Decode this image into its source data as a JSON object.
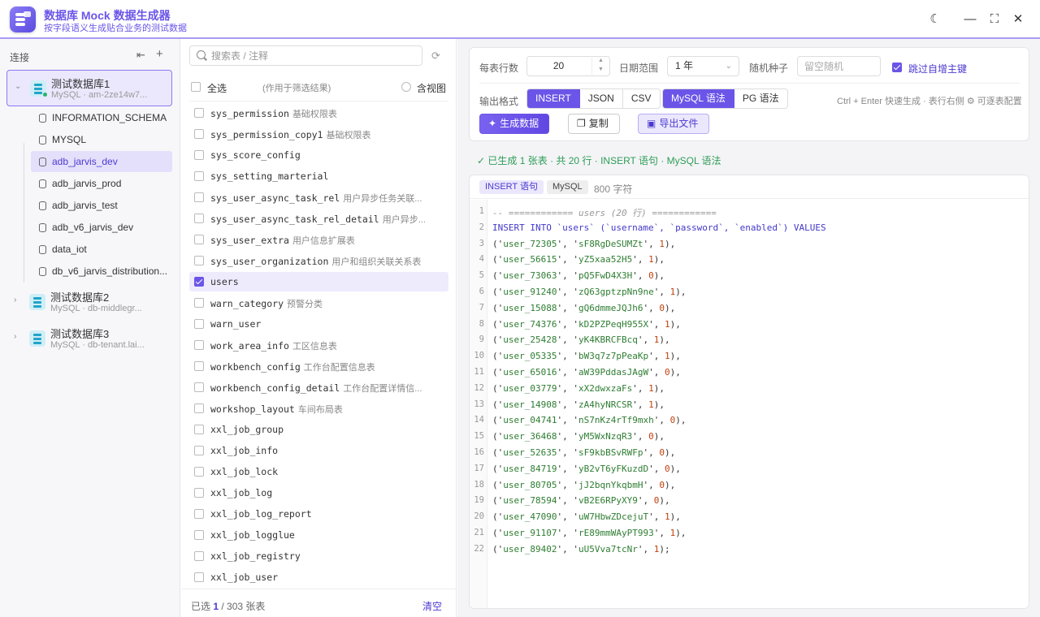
{
  "app": {
    "title": "数据库 Mock 数据生成器",
    "subtitle": "按字段语义生成贴合业务的测试数据"
  },
  "left": {
    "header": "连接",
    "connections": [
      {
        "name": "测试数据库1",
        "sub": "MySQL · am-2ze14w7...",
        "expanded": true
      },
      {
        "name": "测试数据库2",
        "sub": "MySQL · db-middlegr...",
        "expanded": false
      },
      {
        "name": "测试数据库3",
        "sub": "MySQL · db-tenant.lai...",
        "expanded": false
      }
    ],
    "databases": [
      "INFORMATION_SCHEMA",
      "MYSQL",
      "adb_jarvis_dev",
      "adb_jarvis_prod",
      "adb_jarvis_test",
      "adb_v6_jarvis_dev",
      "data_iot",
      "db_v6_jarvis_distribution..."
    ],
    "active_db": "adb_jarvis_dev"
  },
  "mid": {
    "search_placeholder": "搜索表 / 注释",
    "select_all": "全选",
    "select_hint": "(作用于筛选结果)",
    "include_views": "含视图",
    "tables": [
      {
        "name": "sys_permission",
        "comment": "基础权限表",
        "checked": false
      },
      {
        "name": "sys_permission_copy1",
        "comment": "基础权限表",
        "checked": false
      },
      {
        "name": "sys_score_config",
        "comment": "",
        "checked": false
      },
      {
        "name": "sys_setting_marterial",
        "comment": "",
        "checked": false
      },
      {
        "name": "sys_user_async_task_rel",
        "comment": "用户异步任务关联...",
        "checked": false
      },
      {
        "name": "sys_user_async_task_rel_detail",
        "comment": "用户异步...",
        "checked": false
      },
      {
        "name": "sys_user_extra",
        "comment": "用户信息扩展表",
        "checked": false
      },
      {
        "name": "sys_user_organization",
        "comment": "用户和组织关联关系表",
        "checked": false
      },
      {
        "name": "users",
        "comment": "",
        "checked": true
      },
      {
        "name": "warn_category",
        "comment": "预警分类",
        "checked": false
      },
      {
        "name": "warn_user",
        "comment": "",
        "checked": false
      },
      {
        "name": "work_area_info",
        "comment": "工区信息表",
        "checked": false
      },
      {
        "name": "workbench_config",
        "comment": "工作台配置信息表",
        "checked": false
      },
      {
        "name": "workbench_config_detail",
        "comment": "工作台配置详情信...",
        "checked": false
      },
      {
        "name": "workshop_layout",
        "comment": "车间布局表",
        "checked": false
      },
      {
        "name": "xxl_job_group",
        "comment": "",
        "checked": false
      },
      {
        "name": "xxl_job_info",
        "comment": "",
        "checked": false
      },
      {
        "name": "xxl_job_lock",
        "comment": "",
        "checked": false
      },
      {
        "name": "xxl_job_log",
        "comment": "",
        "checked": false
      },
      {
        "name": "xxl_job_log_report",
        "comment": "",
        "checked": false
      },
      {
        "name": "xxl_job_logglue",
        "comment": "",
        "checked": false
      },
      {
        "name": "xxl_job_registry",
        "comment": "",
        "checked": false
      },
      {
        "name": "xxl_job_user",
        "comment": "",
        "checked": false
      }
    ],
    "footer": {
      "prefix": "已选 ",
      "selected": "1",
      "suffix": " / 303 张表",
      "clear": "清空"
    }
  },
  "config": {
    "rows_label": "每表行数",
    "rows_value": "20",
    "date_label": "日期范围",
    "date_value": "1 年",
    "seed_label": "随机种子",
    "seed_placeholder": "留空随机",
    "skip_label": "跳过自增主键",
    "skip_checked": true,
    "format_label": "输出格式",
    "formats": [
      "INSERT",
      "JSON",
      "CSV"
    ],
    "active_format": "INSERT",
    "dialects": [
      "MySQL 语法",
      "PG 语法"
    ],
    "active_dialect": "MySQL 语法",
    "shortcut_hint": "Ctrl + Enter 快速生成 · 表行右侧 ⚙ 可逐表配置",
    "generate": "生成数据",
    "copy": "复制",
    "export": "导出文件"
  },
  "status": "✓ 已生成 1 张表 · 共 20 行 · INSERT 语句 · MySQL 语法",
  "output": {
    "tag_type": "INSERT 语句",
    "tag_dialect": "MySQL",
    "char_count": "800 字符",
    "comment": "-- ============ users (20 行) ============",
    "insert_head": "INSERT INTO `users` (`username`, `password`, `enabled`) VALUES",
    "rows": [
      {
        "u": "user_72305",
        "p": "sF8RgDeSUMZt",
        "e": "1"
      },
      {
        "u": "user_56615",
        "p": "yZ5xaa52H5",
        "e": "1"
      },
      {
        "u": "user_73063",
        "p": "pQ5FwD4X3H",
        "e": "0"
      },
      {
        "u": "user_91240",
        "p": "zQ63gptzpNn9ne",
        "e": "1"
      },
      {
        "u": "user_15088",
        "p": "gQ6dmmeJQJh6",
        "e": "0"
      },
      {
        "u": "user_74376",
        "p": "kD2PZPeqH955X",
        "e": "1"
      },
      {
        "u": "user_25428",
        "p": "yK4KBRCFBcq",
        "e": "1"
      },
      {
        "u": "user_05335",
        "p": "bW3q7z7pPeaKp",
        "e": "1"
      },
      {
        "u": "user_65016",
        "p": "aW39PddasJAgW",
        "e": "0"
      },
      {
        "u": "user_03779",
        "p": "xX2dwxzaFs",
        "e": "1"
      },
      {
        "u": "user_14908",
        "p": "zA4hyNRCSR",
        "e": "1"
      },
      {
        "u": "user_04741",
        "p": "nS7nKz4rTf9mxh",
        "e": "0"
      },
      {
        "u": "user_36468",
        "p": "yM5WxNzqR3",
        "e": "0"
      },
      {
        "u": "user_52635",
        "p": "sF9kbBSvRWFp",
        "e": "0"
      },
      {
        "u": "user_84719",
        "p": "yB2vT6yFKuzdD",
        "e": "0"
      },
      {
        "u": "user_80705",
        "p": "jJ2bqnYkqbmH",
        "e": "0"
      },
      {
        "u": "user_78594",
        "p": "vB2E6RPyXY9",
        "e": "0"
      },
      {
        "u": "user_47090",
        "p": "uW7HbwZDcejuT",
        "e": "1"
      },
      {
        "u": "user_91107",
        "p": "rE89mmWAyPT993",
        "e": "1"
      },
      {
        "u": "user_89402",
        "p": "uU5Vva7tcNr",
        "e": "1"
      }
    ]
  }
}
